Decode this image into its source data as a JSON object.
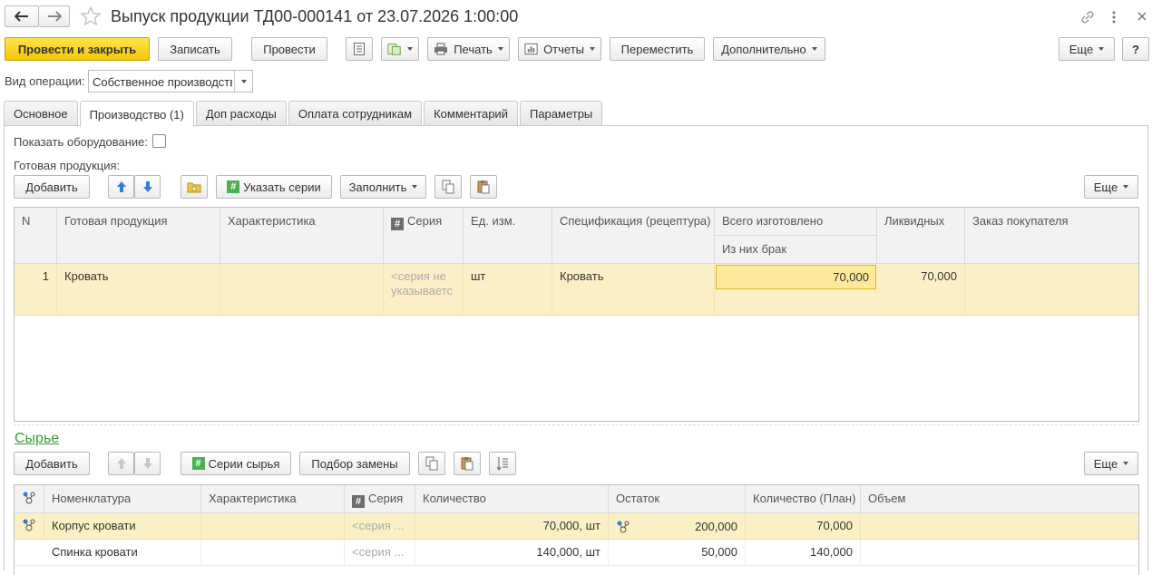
{
  "window": {
    "title": "Выпуск продукции ТД00-000141 от 23.07.2026 1:00:00"
  },
  "toolbar": {
    "post_close": "Провести и закрыть",
    "save": "Записать",
    "post": "Провести",
    "print": "Печать",
    "reports": "Отчеты",
    "move": "Переместить",
    "more_actions": "Дополнительно",
    "more": "Еще",
    "help": "?"
  },
  "operation": {
    "label": "Вид операции:",
    "value": "Собственное производство"
  },
  "tabs": [
    {
      "label": "Основное"
    },
    {
      "label": "Производство (1)"
    },
    {
      "label": "Доп расходы"
    },
    {
      "label": "Оплата сотрудникам"
    },
    {
      "label": "Комментарий"
    },
    {
      "label": "Параметры"
    }
  ],
  "production": {
    "show_equipment_label": "Показать оборудование:",
    "section_label": "Готовая продукция:",
    "add": "Добавить",
    "series": "Указать серии",
    "fill": "Заполнить",
    "more": "Еще",
    "columns": {
      "n": "N",
      "product": "Готовая продукция",
      "characteristic": "Характеристика",
      "series": "Серия",
      "unit": "Ед. изм.",
      "spec": "Спецификация (рецептура)",
      "total": "Всего изготовлено",
      "defect": "Из них брак",
      "liquid": "Ликвидных",
      "order": "Заказ покупателя"
    },
    "rows": [
      {
        "n": "1",
        "product": "Кровать",
        "characteristic": "",
        "series_l1": "<серия не",
        "series_l2": "указываетс",
        "unit": "шт",
        "spec": "Кровать",
        "total": "70,000",
        "liquid": "70,000",
        "order": ""
      }
    ]
  },
  "materials": {
    "title": "Сырье",
    "add": "Добавить",
    "series": "Серии сырья",
    "replace": "Подбор замены",
    "more": "Еще",
    "columns": {
      "nomenclature": "Номенклатура",
      "characteristic": "Характеристика",
      "series": "Серия",
      "quantity": "Количество",
      "remainder": "Остаток",
      "plan": "Количество (План)",
      "volume": "Объем"
    },
    "rows": [
      {
        "name": "Корпус кровати",
        "characteristic": "",
        "series": "<серия ...",
        "quantity": "70,000, шт",
        "remainder": "200,000",
        "plan": "70,000",
        "volume": ""
      },
      {
        "name": "Спинка кровати",
        "characteristic": "",
        "series": "<серия ...",
        "quantity": "140,000, шт",
        "remainder": "50,000",
        "plan": "140,000",
        "volume": ""
      }
    ]
  }
}
